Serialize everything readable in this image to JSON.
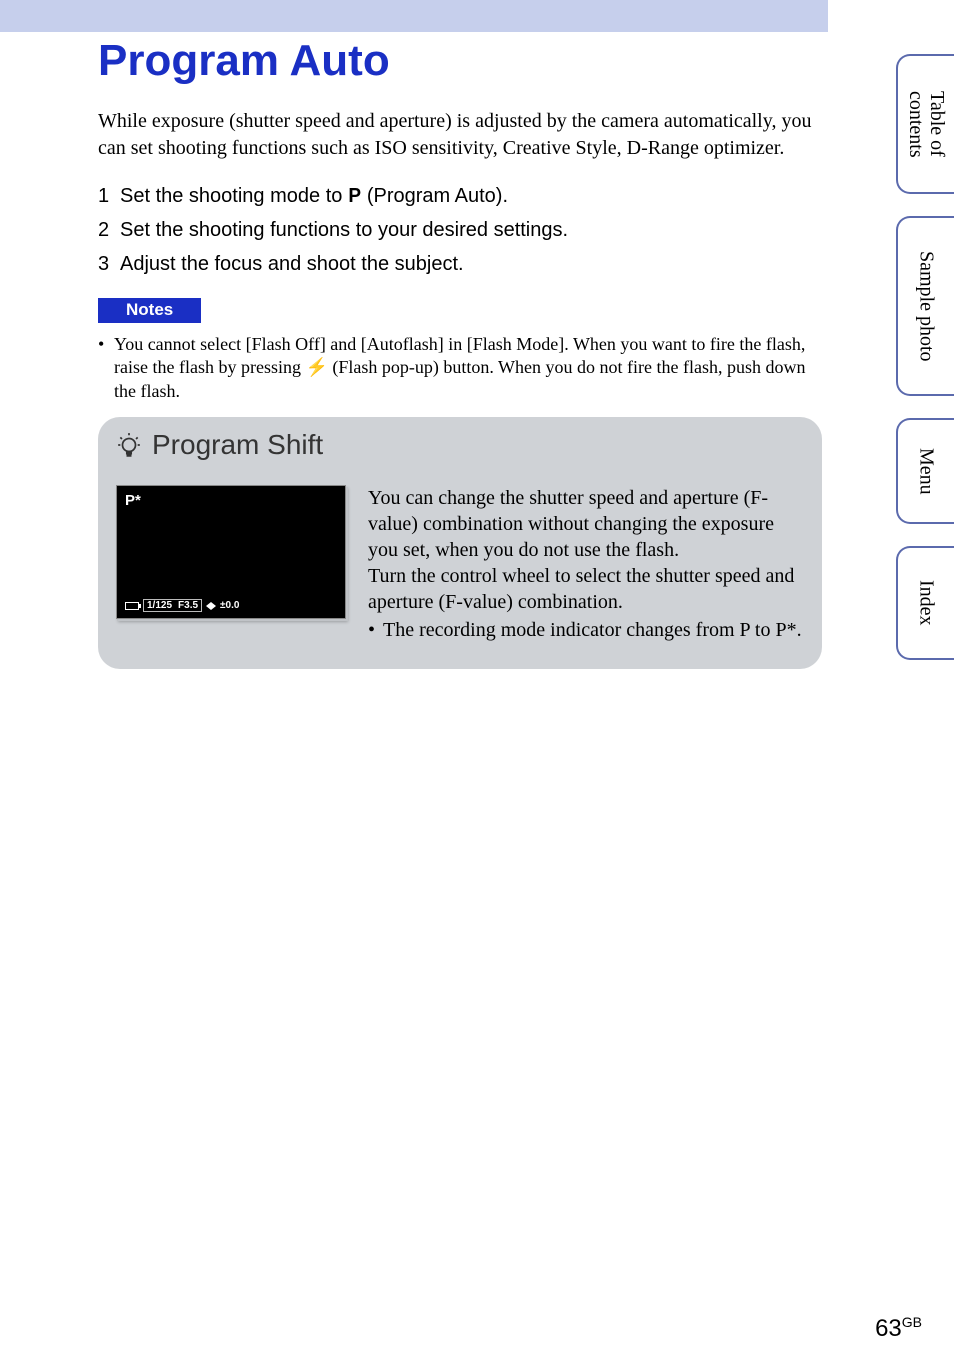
{
  "sideTabs": {
    "toc": "Table of\ncontents",
    "sample": "Sample photo",
    "menu": "Menu",
    "index": "Index"
  },
  "title": "Program Auto",
  "intro": "While exposure (shutter speed and aperture) is adjusted by the camera automatically, you can set shooting functions such as ISO sensitivity, Creative Style, D-Range optimizer.",
  "steps": {
    "n1": "1",
    "s1a": "Set the shooting mode to ",
    "s1_icon": "P",
    "s1b": " (Program Auto).",
    "n2": "2",
    "s2": "Set the shooting functions to your desired settings.",
    "n3": "3",
    "s3": "Adjust the focus and shoot the subject."
  },
  "notesLabel": "Notes",
  "note": {
    "bullet": "•",
    "part1": "You cannot select [Flash Off] and [Autoflash] in [Flash Mode]. When you want to fire the flash, raise the flash by pressing ",
    "part2": " (Flash pop-up) button. When you do not fire the flash, push down the flash."
  },
  "tip": {
    "title": "Program Shift",
    "lcd": {
      "mode": "P*",
      "shutter": "1/125",
      "aperture": "F3.5",
      "ev": "±0.0"
    },
    "para1": "You can change the shutter speed and aperture (F-value) combination without changing the exposure you set, when you do not use the flash.",
    "para2": "Turn the control wheel to select the shutter speed and aperture (F-value) combination.",
    "bullet": "•",
    "bulletText": "The recording mode indicator changes from P to P*."
  },
  "pageNumber": "63",
  "pageSuffix": "GB"
}
